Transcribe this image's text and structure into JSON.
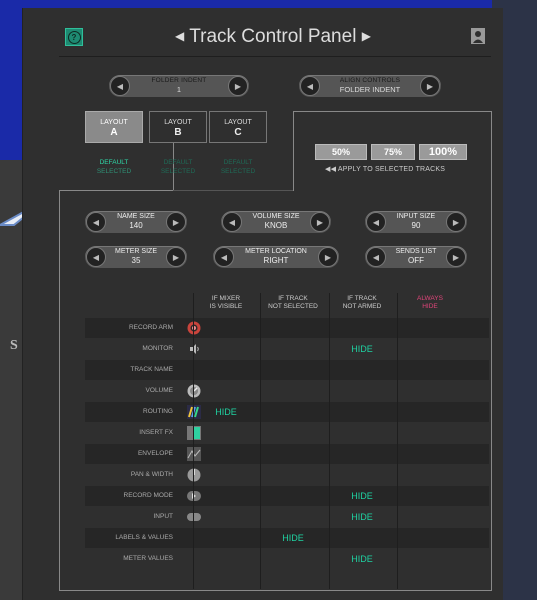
{
  "header": {
    "title": "Track Control Panel",
    "prev_glyph": "◀",
    "next_glyph": "▶",
    "help_icon": "help-icon",
    "user_icon": "user-icon"
  },
  "top_steppers": {
    "folder_indent": {
      "label": "FOLDER INDENT",
      "value": "1"
    },
    "align_controls": {
      "label": "ALIGN CONTROLS",
      "value": "FOLDER INDENT"
    }
  },
  "layouts": [
    {
      "line1": "LAYOUT",
      "line2": "A",
      "status1": "DEFAULT",
      "status2": "SELECTED"
    },
    {
      "line1": "LAYOUT",
      "line2": "B",
      "status1": "DEFAULT",
      "status2": "SELECTED"
    },
    {
      "line1": "LAYOUT",
      "line2": "C",
      "status1": "DEFAULT",
      "status2": "SELECTED"
    }
  ],
  "scale": {
    "options": [
      "50%",
      "75%",
      "100%"
    ],
    "apply_label": "◀◀  APPLY TO SELECTED TRACKS"
  },
  "settings": {
    "name_size": {
      "label": "NAME SIZE",
      "value": "140"
    },
    "volume_size": {
      "label": "VOLUME SIZE",
      "value": "KNOB"
    },
    "input_size": {
      "label": "INPUT SIZE",
      "value": "90"
    },
    "meter_size": {
      "label": "METER SIZE",
      "value": "35"
    },
    "meter_location": {
      "label": "METER LOCATION",
      "value": "RIGHT"
    },
    "sends_list": {
      "label": "SENDS LIST",
      "value": "OFF"
    }
  },
  "visibility": {
    "columns": [
      {
        "line1": "IF MIXER",
        "line2": "IS VISIBLE"
      },
      {
        "line1": "IF TRACK",
        "line2": "NOT SELECTED"
      },
      {
        "line1": "IF TRACK",
        "line2": "NOT ARMED"
      },
      {
        "line1": "ALWAYS",
        "line2": "HIDE"
      }
    ],
    "rows": [
      {
        "label": "RECORD ARM",
        "icon": "record-arm-icon",
        "cells": [
          "",
          "",
          "",
          ""
        ]
      },
      {
        "label": "MONITOR",
        "icon": "speaker-icon",
        "cells": [
          "",
          "",
          "HIDE",
          ""
        ]
      },
      {
        "label": "TRACK NAME",
        "icon": "",
        "cells": [
          "",
          "",
          "",
          ""
        ]
      },
      {
        "label": "VOLUME",
        "icon": "volume-knob-icon",
        "cells": [
          "",
          "",
          "",
          ""
        ]
      },
      {
        "label": "ROUTING",
        "icon": "routing-icon",
        "cells": [
          "HIDE",
          "",
          "",
          ""
        ]
      },
      {
        "label": "INSERT FX",
        "icon": "insert-fx-icon",
        "cells": [
          "",
          "",
          "",
          ""
        ]
      },
      {
        "label": "ENVELOPE",
        "icon": "envelope-icon",
        "cells": [
          "",
          "",
          "",
          ""
        ]
      },
      {
        "label": "PAN & WIDTH",
        "icon": "pan-knob-icon",
        "cells": [
          "",
          "",
          "",
          ""
        ]
      },
      {
        "label": "RECORD MODE",
        "icon": "record-mode-icon",
        "cells": [
          "",
          "",
          "HIDE",
          ""
        ]
      },
      {
        "label": "INPUT",
        "icon": "input-icon",
        "cells": [
          "",
          "",
          "HIDE",
          ""
        ]
      },
      {
        "label": "LABELS & VALUES",
        "icon": "",
        "cells": [
          "",
          "HIDE",
          "",
          ""
        ]
      },
      {
        "label": "METER VALUES",
        "icon": "",
        "cells": [
          "",
          "",
          "HIDE",
          ""
        ]
      }
    ]
  },
  "background": {
    "left_letter": "S"
  },
  "colors": {
    "accent_teal": "#1fd2a2",
    "always_hide_pink": "#e0457a",
    "panel_bg": "#2f2f2f"
  }
}
